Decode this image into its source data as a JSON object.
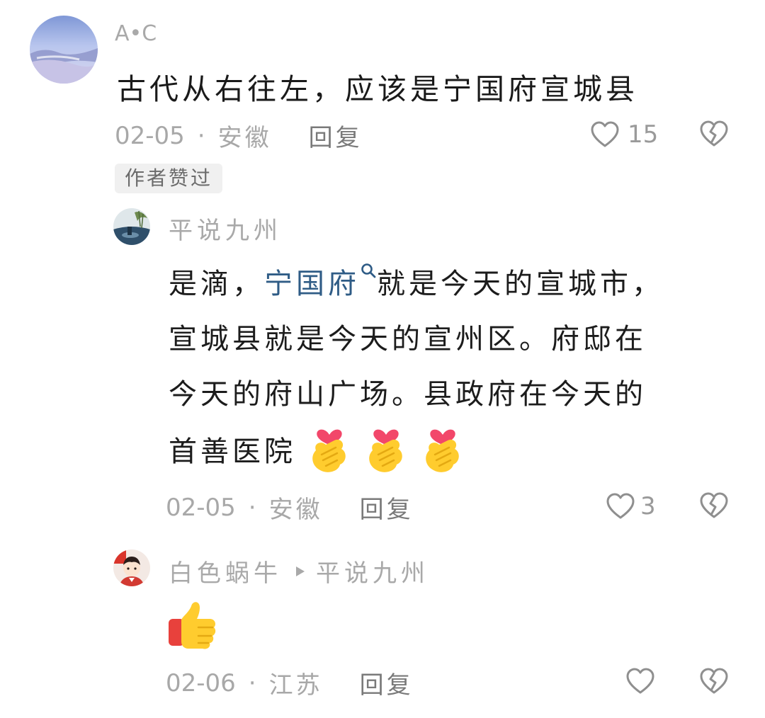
{
  "comments": [
    {
      "username": "A•C",
      "text": "古代从右往左，应该是宁国府宣城县",
      "date": "02-05",
      "location": "安徽",
      "reply_label": "回复",
      "likes": "15",
      "badge": "作者赞过",
      "avatar": "landscape-avatar"
    }
  ],
  "replies": [
    {
      "username": "平说九州",
      "segments": {
        "l1_a": "是滴，",
        "l1_link": "宁国府",
        "l1_b": "就是今天的宣城市，",
        "l2": "宣城县就是今天的宣州区。府邸在",
        "l3": "今天的府山广场。县政府在今天的",
        "l4": "首善医院"
      },
      "emoji": [
        "finger-heart-emoji",
        "finger-heart-emoji",
        "finger-heart-emoji"
      ],
      "date": "02-05",
      "location": "安徽",
      "reply_label": "回复",
      "likes": "3",
      "avatar": "lake-avatar"
    },
    {
      "username": "白色蜗牛",
      "reply_to": "平说九州",
      "emoji": [
        "thumbs-up-emoji"
      ],
      "date": "02-06",
      "location": "江苏",
      "reply_label": "回复",
      "likes": "",
      "avatar": "cartoon-avatar"
    }
  ],
  "colors": {
    "link": "#2f5c86",
    "muted": "#a8a8a8",
    "badge_bg": "#f0f0f0"
  }
}
